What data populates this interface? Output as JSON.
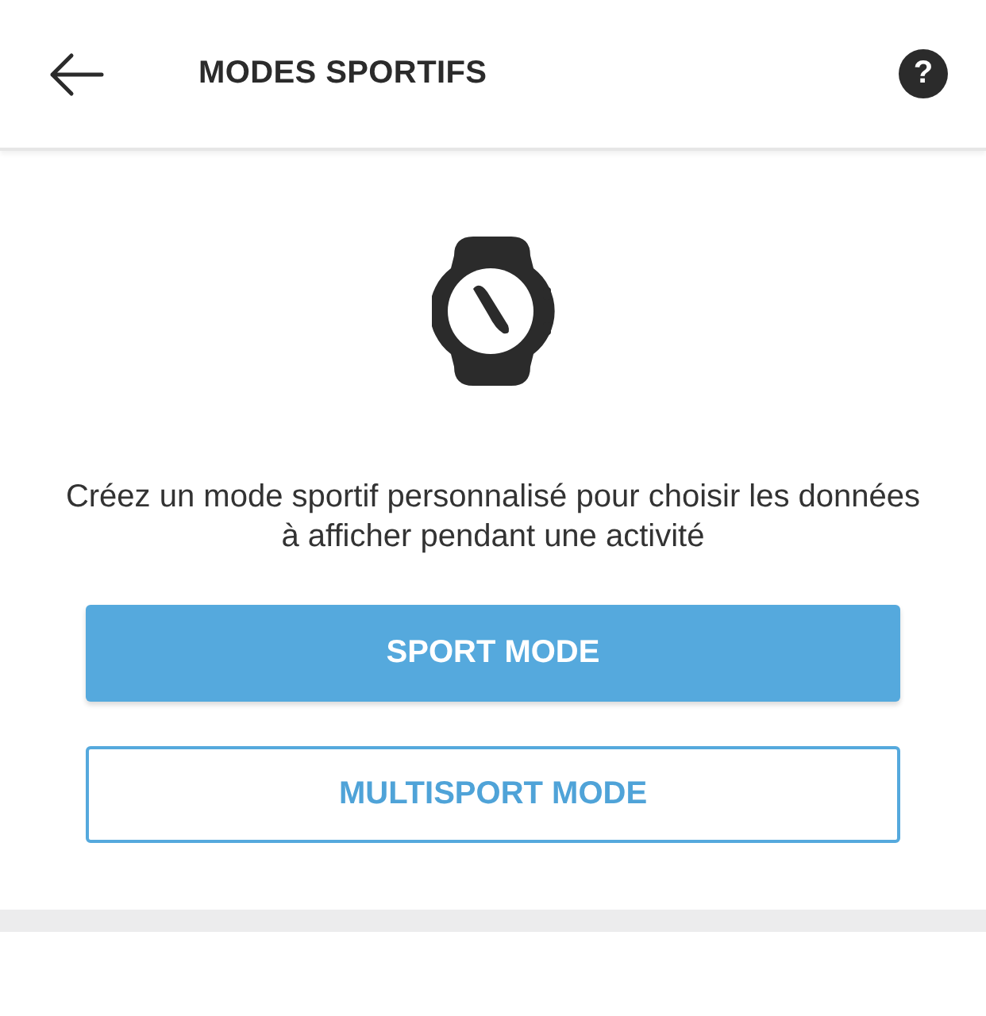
{
  "header": {
    "title": "MODES SPORTIFS",
    "help": "?"
  },
  "description": "Créez un mode sportif personnalisé pour choisir les données à afficher pendant une activité",
  "buttons": [
    {
      "label": "SPORT MODE",
      "kind": "primary"
    },
    {
      "label": "MULTISPORT MODE",
      "kind": "outline"
    }
  ]
}
